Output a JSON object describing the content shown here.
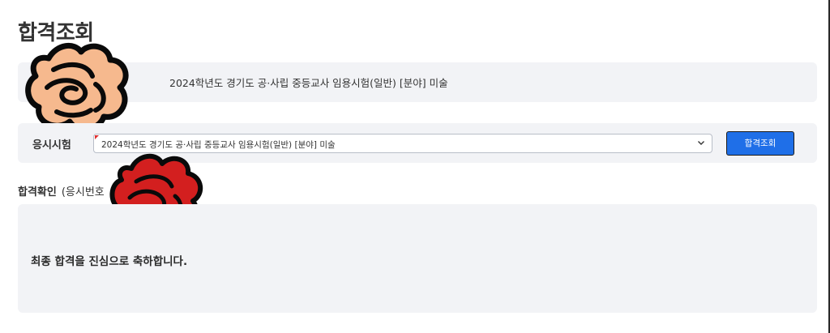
{
  "page": {
    "title": "합격조회"
  },
  "info": {
    "exam_name": "2024학년도 경기도 공·사립 중등교사 임용시험(일반) [분야] 미술"
  },
  "exam_select": {
    "label": "응시시험",
    "selected": "2024학년도 경기도 공·사립 중등교사 임용시험(일반) [분야] 미술",
    "button_label": "합격조회"
  },
  "result": {
    "section_title": "합격확인",
    "section_subtitle": "(응시번호",
    "message": "최종 합격을 진심으로 축하합니다."
  },
  "colors": {
    "panel_bg": "#f2f3f6",
    "button_bg": "#1f6fe8",
    "scribble_peach": "#f6b98e",
    "scribble_red": "#d31f1f"
  },
  "icons": {
    "select_arrow": "chevron-down-icon"
  }
}
